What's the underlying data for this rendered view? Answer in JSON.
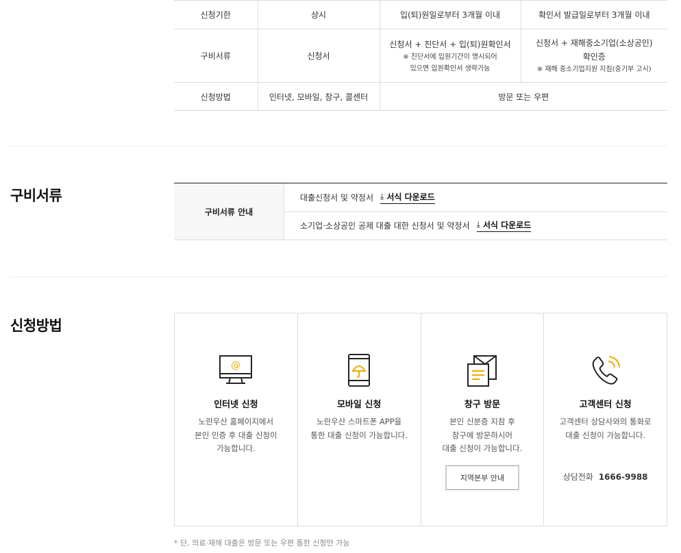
{
  "schedule_table": {
    "rows": [
      {
        "label": "신청기한",
        "col2": "상시",
        "col3": "입(퇴)원일로부터 3개월 이내",
        "col4": "확인서 발급일로부터 3개월 이내"
      },
      {
        "label": "구비서류",
        "col2": "신청서",
        "col3_main": "신청서 + 진단서 + 입(퇴)원확인서",
        "col3_note": "※ 진단서에 입원기간이 명시되어\n있으면 입원확인서 생략가능",
        "col4_main": "신청서 + 재해중소기업(소상공인)\n확인증",
        "col4_note": "※ 재해 중소기업지원 지침(중기부 고시)"
      },
      {
        "label": "신청방법",
        "col2": "인터넷, 모바일, 창구, 콜센터",
        "col34": "방문 또는 우편"
      }
    ]
  },
  "documents": {
    "title": "구비서류",
    "head": "구비서류 안내",
    "items": [
      {
        "text": "대출신청서 및 약정서",
        "link": "서식 다운로드"
      },
      {
        "text": "소기업·소상공인 공제 대출 대한 신청서 및 약정서",
        "link": "서식 다운로드"
      }
    ]
  },
  "methods": {
    "title": "신청방법",
    "cards": [
      {
        "icon": "monitor-at-icon",
        "title": "인터넷 신청",
        "desc": "노란우산 홈페이지에서\n본인 인증 후 대출 신청이\n가능합니다."
      },
      {
        "icon": "smartphone-umbrella-icon",
        "title": "모바일 신청",
        "desc": "노란우산 스마트폰 APP을\n통한 대출 신청이 가능합니다."
      },
      {
        "icon": "envelope-document-icon",
        "title": "창구 방문",
        "desc": "본인 신분증 지참 후\n창구에 방문하시어\n대출 신청이 가능합니다.",
        "button": "지역본부 안내"
      },
      {
        "icon": "phone-call-icon",
        "title": "고객센터 신청",
        "desc": "고객센터 상담사와의 통화로\n대출 신청이 가능합니다.",
        "phone_label": "상담전화",
        "phone_number": "1666-9988"
      }
    ]
  },
  "footnote": "* 단, 의료·재해 대출은 방문 또는 우편 통한 신청만 가능",
  "colors": {
    "accent": "#f2a900",
    "border": "#dcdcdc",
    "text": "#222222"
  }
}
